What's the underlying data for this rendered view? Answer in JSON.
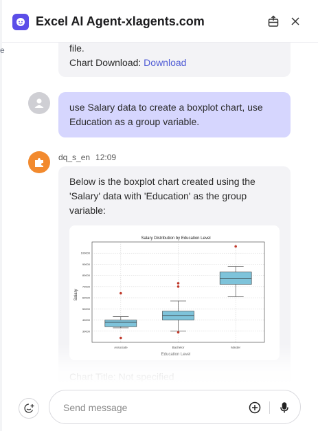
{
  "header": {
    "title": "Excel AI Agent-xlagents.com",
    "logo_icon": "robot-face-icon",
    "share_icon": "export-icon",
    "close_icon": "close-icon"
  },
  "messages": {
    "prev_ai": {
      "line1": "file.",
      "line2_prefix": "Chart Download: ",
      "download_link": "Download"
    },
    "user": {
      "avatar_icon": "user-icon",
      "line1": "use Salary data to create a boxplot chart, use",
      "line2": "Education as a group variable."
    },
    "ai": {
      "sender": "dq_s_en",
      "time": "12:09",
      "avatar_icon": "puzzle-icon",
      "line1": "Below is the boxplot chart created using the",
      "line2": "'Salary' data with 'Education' as the group",
      "line3": "variable:",
      "footer_text": "Chart Title: Not specified"
    }
  },
  "chart_data": {
    "type": "boxplot",
    "title": "Salary Distribution by Education Level",
    "xlabel": "Education Level",
    "ylabel": "Salary",
    "ylim": [
      20000,
      110000
    ],
    "yticks": [
      "30000",
      "40000",
      "50000",
      "60000",
      "70000",
      "80000",
      "90000",
      "100000"
    ],
    "categories": [
      "Associate",
      "Bachelor",
      "Master"
    ],
    "boxes": [
      {
        "name": "Associate",
        "whisker_low": 33000,
        "q1": 34000,
        "median": 38000,
        "q3": 40000,
        "whisker_high": 43000,
        "outliers": [
          64000,
          24000
        ]
      },
      {
        "name": "Bachelor",
        "whisker_low": 30000,
        "q1": 40000,
        "median": 44000,
        "q3": 48000,
        "whisker_high": 57000,
        "outliers": [
          73000,
          70000,
          29000
        ]
      },
      {
        "name": "Master",
        "whisker_low": 61000,
        "q1": 72000,
        "median": 77000,
        "q3": 83000,
        "whisker_high": 88000,
        "outliers": [
          106000
        ]
      }
    ],
    "box_color": "#7ec3da",
    "outlier_color": "#c0392b",
    "grid": true,
    "legend": "none"
  },
  "composer": {
    "placeholder": "Send message",
    "value": "",
    "new_chat_icon": "new-chat-icon",
    "add_icon": "plus-circle-icon",
    "mic_icon": "microphone-icon"
  },
  "colors": {
    "accent": "#5b4ee8",
    "user_bubble": "#d6d6fe",
    "ai_bubble": "#f3f3f6",
    "link": "#4f5bd5"
  }
}
